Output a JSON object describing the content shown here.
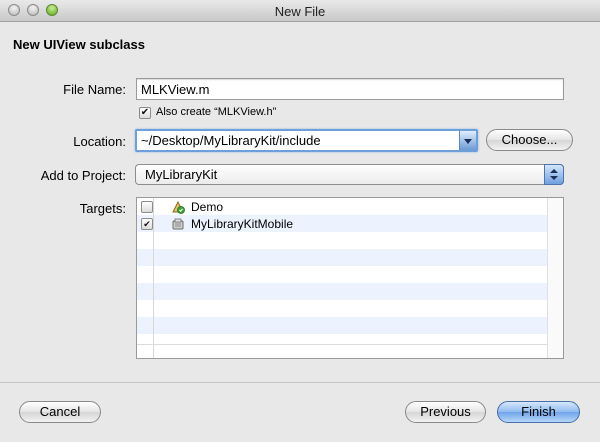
{
  "window": {
    "title": "New File"
  },
  "heading": "New UIView subclass",
  "file_name": {
    "label": "File Name:",
    "value": "MLKView.m"
  },
  "also_create": {
    "label": "Also create “MLKView.h”",
    "checked": true
  },
  "location": {
    "label": "Location:",
    "value": "~/Desktop/MyLibraryKit/include",
    "choose_label": "Choose..."
  },
  "add_to_project": {
    "label": "Add to Project:",
    "value": "MyLibraryKit"
  },
  "targets": {
    "label": "Targets:",
    "items": [
      {
        "name": "Demo",
        "checked": false,
        "check_text": "",
        "icon": "app-target-icon"
      },
      {
        "name": "MyLibraryKitMobile",
        "checked": true,
        "check_text": "✔",
        "icon": "library-target-icon"
      }
    ]
  },
  "buttons": {
    "cancel": "Cancel",
    "previous": "Previous",
    "finish": "Finish"
  },
  "colors": {
    "accent": "#6fa4e9",
    "row_alt": "#edf3fe",
    "window_bg": "#e8e8e8"
  }
}
